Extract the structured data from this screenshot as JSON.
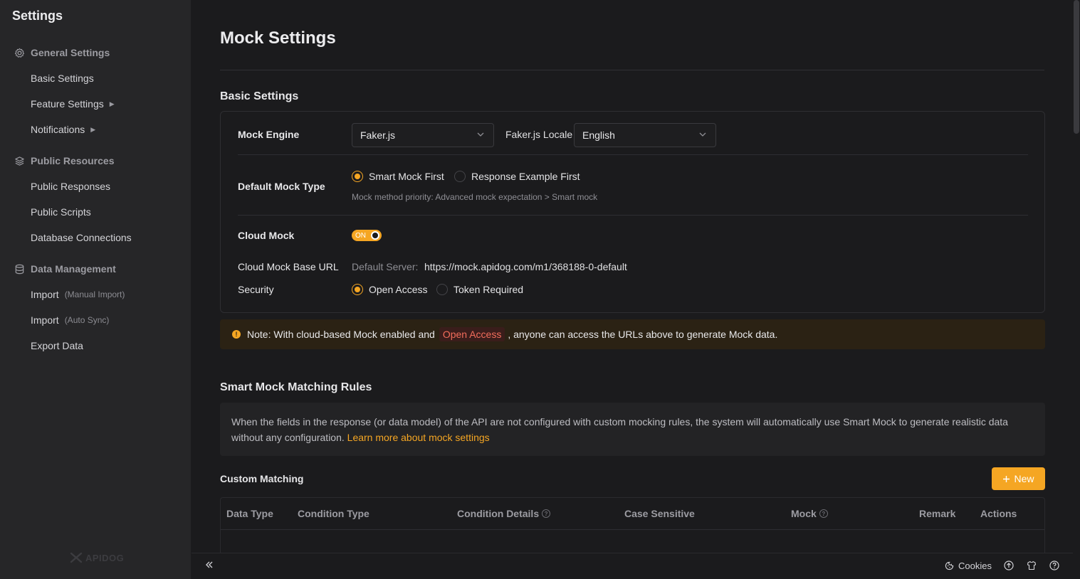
{
  "sidebar": {
    "title": "Settings",
    "groups": [
      {
        "label": "General Settings",
        "icon": "gear-icon",
        "items": [
          {
            "label": "Basic Settings",
            "sub": "",
            "caret": ""
          },
          {
            "label": "Feature Settings",
            "sub": "",
            "caret": "▶"
          },
          {
            "label": "Notifications",
            "sub": "",
            "caret": "▶"
          }
        ]
      },
      {
        "label": "Public Resources",
        "icon": "layers-icon",
        "items": [
          {
            "label": "Public Responses",
            "sub": "",
            "caret": ""
          },
          {
            "label": "Public Scripts",
            "sub": "",
            "caret": ""
          },
          {
            "label": "Database Connections",
            "sub": "",
            "caret": ""
          }
        ]
      },
      {
        "label": "Data Management",
        "icon": "database-icon",
        "items": [
          {
            "label": "Import",
            "sub": "(Manual Import)",
            "caret": ""
          },
          {
            "label": "Import",
            "sub": "(Auto Sync)",
            "caret": ""
          },
          {
            "label": "Export Data",
            "sub": "",
            "caret": ""
          }
        ]
      }
    ],
    "brand": "APIDOG"
  },
  "main": {
    "title": "Mock Settings",
    "basic": {
      "section_title": "Basic Settings",
      "mock_engine_label": "Mock Engine",
      "mock_engine_value": "Faker.js",
      "locale_label": "Faker.js Locale",
      "locale_value": "English",
      "default_type_label": "Default Mock Type",
      "type_options": [
        "Smart Mock First",
        "Response Example First"
      ],
      "type_selected": 0,
      "type_hint": "Mock method priority: Advanced mock expectation > Smart mock",
      "cloud_mock_label": "Cloud Mock",
      "cloud_mock_toggle": "ON",
      "base_url_label": "Cloud Mock Base URL",
      "default_server_label": "Default Server:",
      "base_url_value": "https://mock.apidog.com/m1/368188-0-default",
      "security_label": "Security",
      "security_options": [
        "Open Access",
        "Token Required"
      ],
      "security_selected": 0
    },
    "note": {
      "icon": "warning-icon",
      "before": "Note: With cloud-based Mock enabled and",
      "tag": "Open Access",
      "after": ", anyone can access the URLs above to generate Mock data."
    },
    "smart": {
      "section_title": "Smart Mock Matching Rules",
      "description": "When the fields in the response (or data model) of the API are not configured with custom mocking rules, the system will automatically use Smart Mock to generate realistic data without any configuration.",
      "learn_more": "Learn more about mock settings"
    },
    "custom": {
      "title": "Custom Matching",
      "new_button": "New",
      "columns": [
        "Data Type",
        "Condition Type",
        "Condition Details",
        "Case Sensitive",
        "Mock",
        "Remark",
        "Actions"
      ]
    }
  },
  "bottom": {
    "cookies_label": "Cookies",
    "icons": [
      "collapse-icon",
      "cookie-icon",
      "upload-icon",
      "shirt-icon",
      "help-icon"
    ]
  },
  "colors": {
    "accent": "#f5a623",
    "danger": "#f26d5b"
  }
}
